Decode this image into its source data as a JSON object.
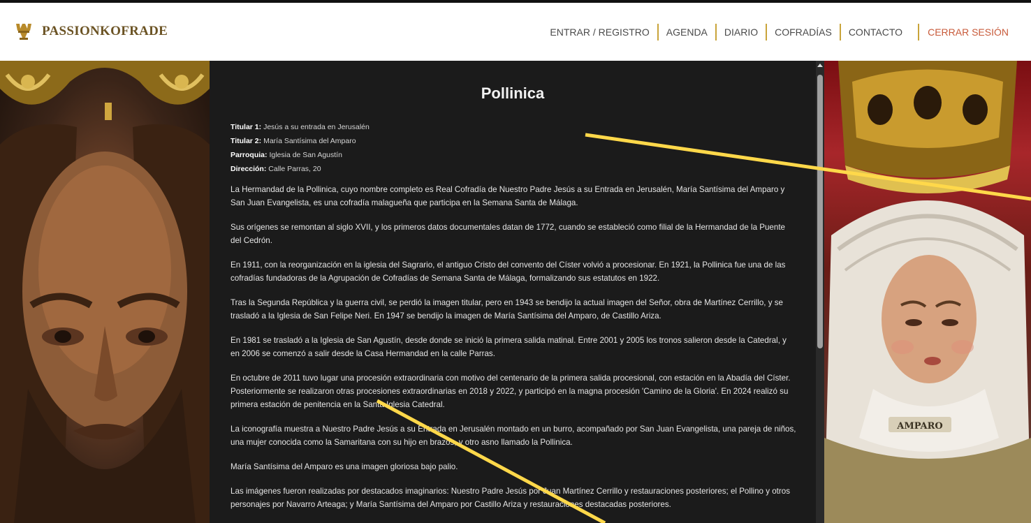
{
  "brand": {
    "name": "PASSIONKOFRADE"
  },
  "nav": {
    "items": [
      "ENTRAR / REGISTRO",
      "AGENDA",
      "DIARIO",
      "COFRADÍAS",
      "CONTACTO"
    ],
    "logout": "CERRAR SESIÓN"
  },
  "article": {
    "title": "Pollinica",
    "meta": [
      {
        "label": "Titular 1:",
        "value": "Jesús a su entrada en Jerusalén"
      },
      {
        "label": "Titular 2:",
        "value": "María Santísima del Amparo"
      },
      {
        "label": "Parroquia:",
        "value": "Iglesia de San Agustín"
      },
      {
        "label": "Dirección:",
        "value": "Calle Parras, 20"
      }
    ],
    "paragraphs": [
      "La Hermandad de la Pollinica, cuyo nombre completo es Real Cofradía de Nuestro Padre Jesús a su Entrada en Jerusalén, María Santísima del Amparo y San Juan Evangelista, es una cofradía malagueña que participa en la Semana Santa de Málaga.",
      "Sus orígenes se remontan al siglo XVII, y los primeros datos documentales datan de 1772, cuando se estableció como filial de la Hermandad de la Puente del Cedrón.",
      "En 1911, con la reorganización en la iglesia del Sagrario, el antiguo Cristo del convento del Císter volvió a procesionar. En 1921, la Pollinica fue una de las cofradías fundadoras de la Agrupación de Cofradías de Semana Santa de Málaga, formalizando sus estatutos en 1922.",
      "Tras la Segunda República y la guerra civil, se perdió la imagen titular, pero en 1943 se bendijo la actual imagen del Señor, obra de Martínez Cerrillo, y se trasladó a la Iglesia de San Felipe Neri. En 1947 se bendijo la imagen de María Santísima del Amparo, de Castillo Ariza.",
      "En 1981 se trasladó a la Iglesia de San Agustín, desde donde se inició la primera salida matinal. Entre 2001 y 2005 los tronos salieron desde la Catedral, y en 2006 se comenzó a salir desde la Casa Hermandad en la calle Parras.",
      "En octubre de 2011 tuvo lugar una procesión extraordinaria con motivo del centenario de la primera salida procesional, con estación en la Abadía del Císter. Posteriormente se realizaron otras procesiones extraordinarias en 2018 y 2022, y participó en la magna procesión 'Camino de la Gloria'. En 2024 realizó su primera estación de penitencia en la Santa Iglesia Catedral.",
      "La iconografía muestra a Nuestro Padre Jesús a su Entrada en Jerusalén montado en un burro, acompañado por San Juan Evangelista, una pareja de niños, una mujer conocida como la Samaritana con su hijo en brazos, y otro asno llamado la Pollinica.",
      "María Santísima del Amparo es una imagen gloriosa bajo palio.",
      "Las imágenes fueron realizadas por destacados imaginarios: Nuestro Padre Jesús por Juan Martínez Cerrillo y restauraciones posteriores; el Pollino y otros personajes por Navarro Arteaga; y María Santísima del Amparo por Castillo Ariza y restauraciones destacadas posteriores."
    ]
  },
  "images": {
    "right_badge": "AMPARO"
  },
  "colors": {
    "accent_gold": "#c9a43a",
    "logout_red": "#c85a3a",
    "panel_bg": "#1b1b1b"
  }
}
